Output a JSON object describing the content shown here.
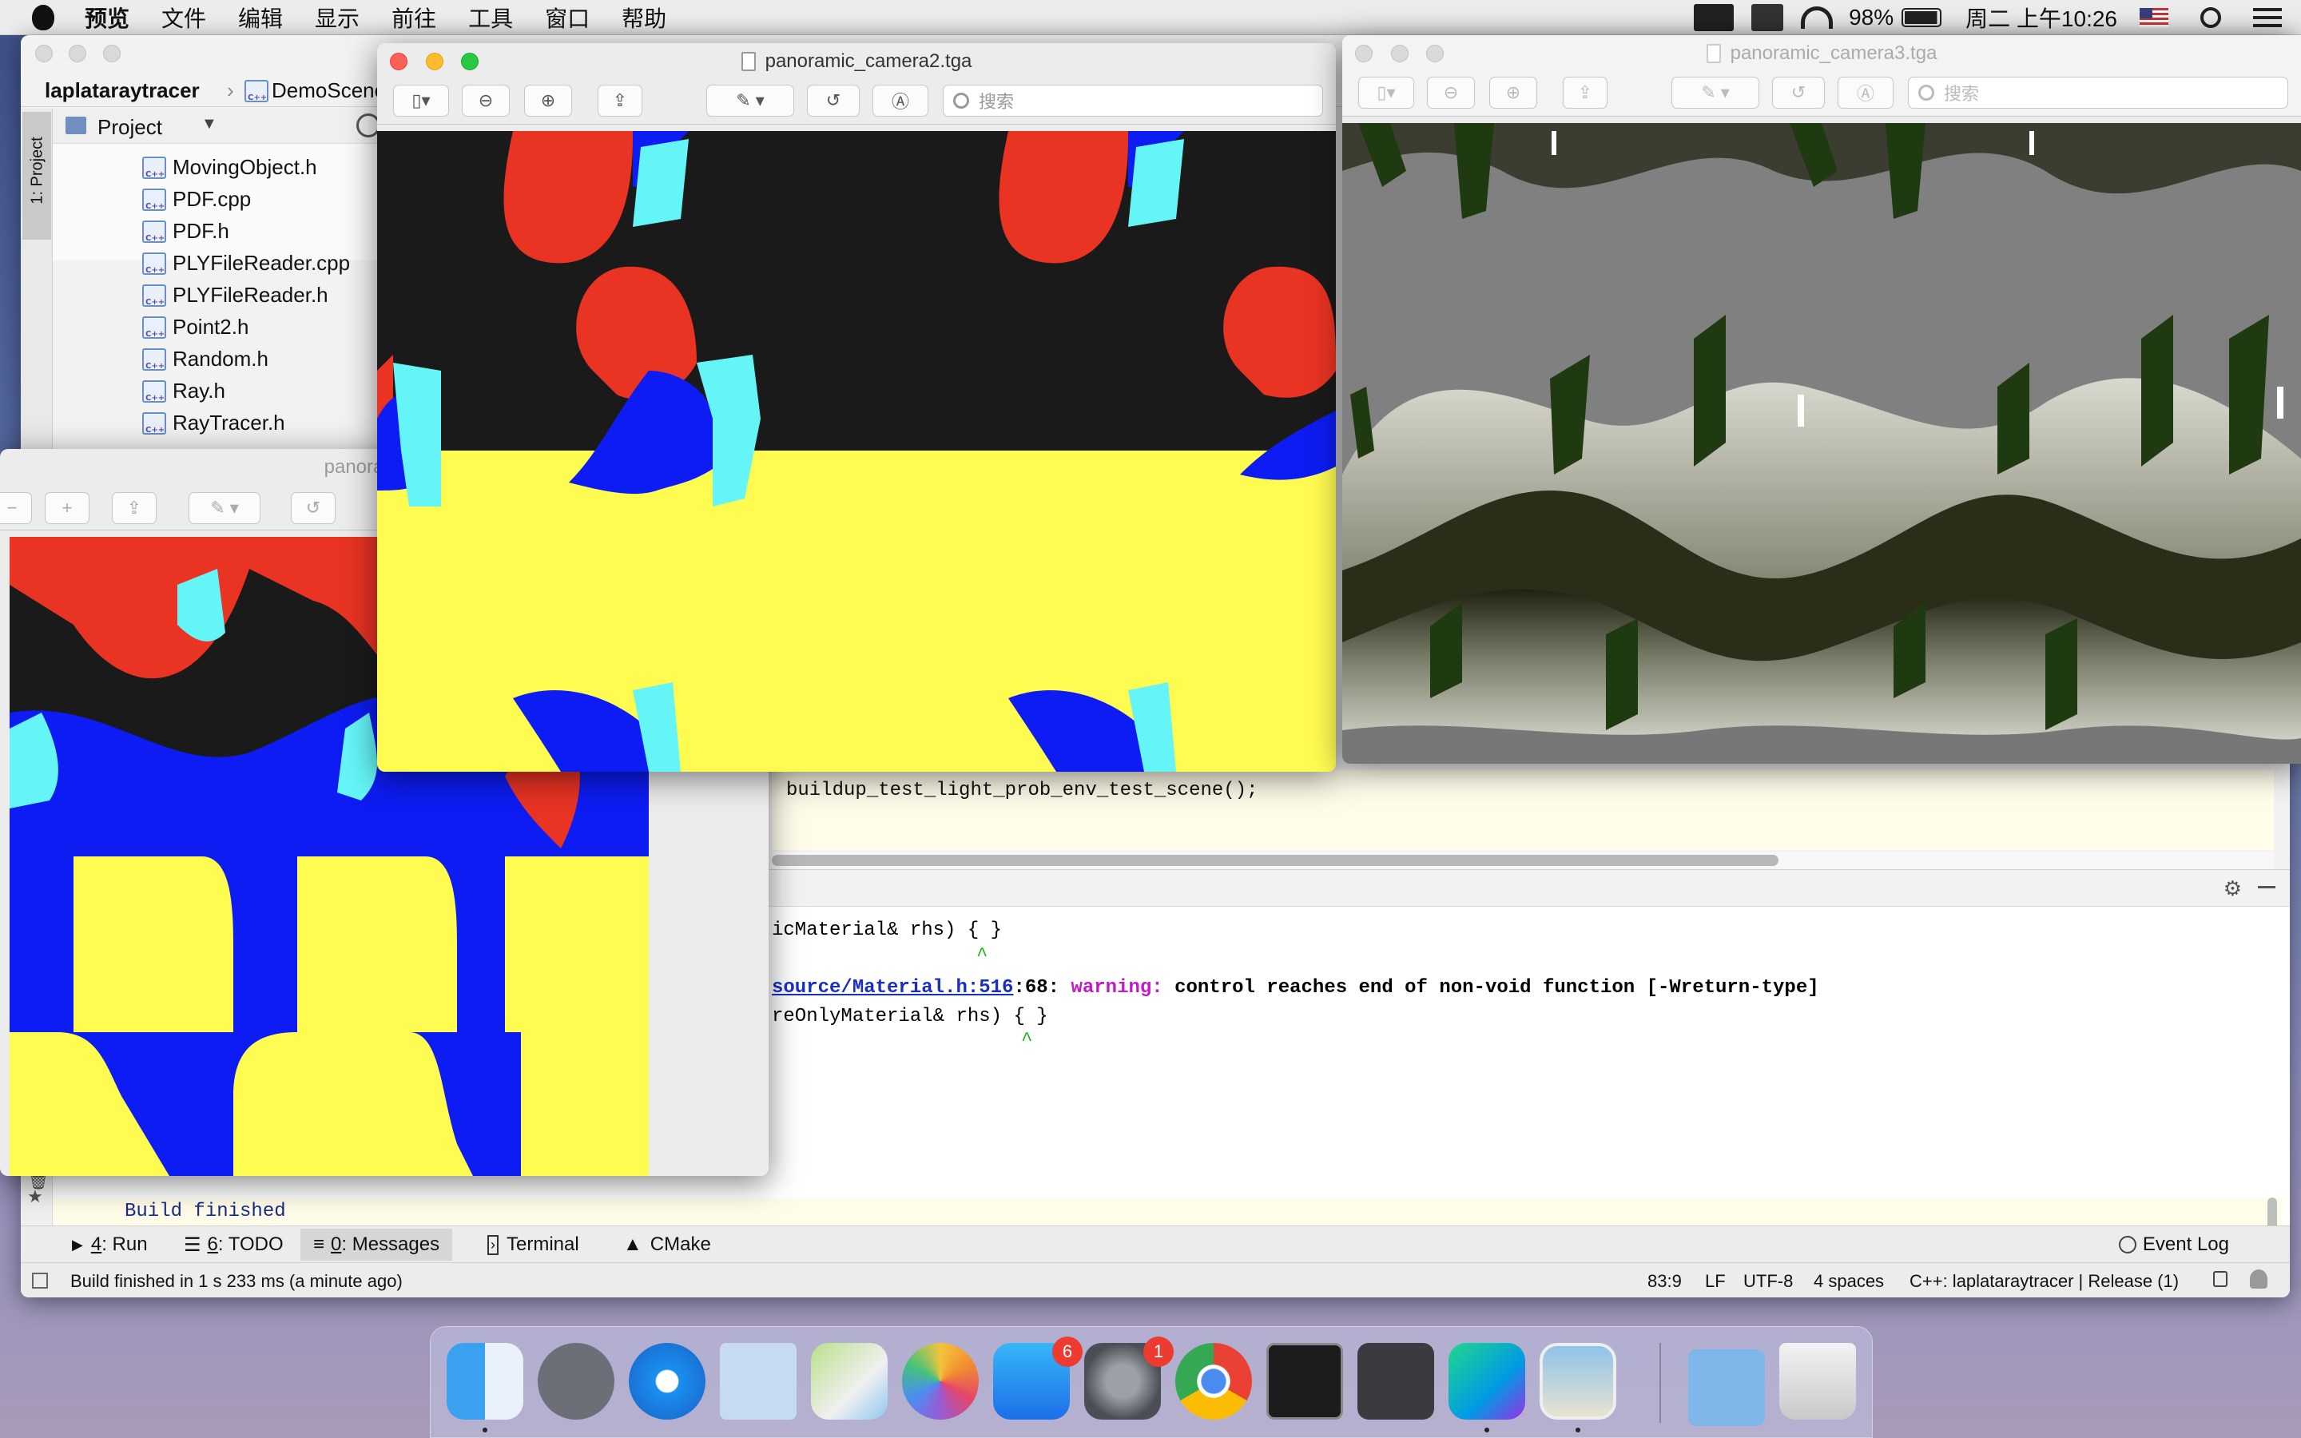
{
  "menubar": {
    "app_name": "预览",
    "items": [
      "文件",
      "编辑",
      "显示",
      "前往",
      "工具",
      "窗口",
      "帮助"
    ],
    "battery": "98%",
    "clock": "周二 上午10:26"
  },
  "ide": {
    "breadcrumb_project": "laplataraytracer",
    "breadcrumb_file": "DemoScene",
    "project_label": "Project",
    "side_tab": "1: Project",
    "files": [
      "MovingObject.h",
      "PDF.cpp",
      "PDF.h",
      "PLYFileReader.cpp",
      "PLYFileReader.h",
      "Point2.h",
      "Random.h",
      "Ray.h",
      "RayTracer.h"
    ],
    "code_lines": [
      "buildup_test_light_prob_env_test_scene();"
    ],
    "messages": [
      {
        "text": "icMaterial& rhs) { }",
        "kind": "code"
      },
      {
        "text": "^",
        "kind": "caret"
      },
      {
        "link": "source/Material.h:516",
        "pos": ":68: ",
        "warn": "warning:",
        "msg": " control reaches end of non-void function [-Wreturn-type]"
      },
      {
        "text": "reOnlyMaterial& rhs) { }",
        "kind": "code"
      },
      {
        "text": "^",
        "kind": "caret"
      }
    ],
    "build_finished": "Build finished",
    "tabs": [
      {
        "num": "4",
        "label": ": Run"
      },
      {
        "num": "6",
        "label": ": TODO"
      },
      {
        "num": "0",
        "label": ": Messages"
      },
      {
        "num": "",
        "label": "Terminal"
      },
      {
        "num": "",
        "label": "CMake"
      }
    ],
    "event_log": "Event Log",
    "status": {
      "message": "Build finished in 1 s 233 ms (a minute ago)",
      "position": "83:9",
      "line_sep": "LF",
      "encoding": "UTF-8",
      "indent": "4 spaces",
      "context": "C++: laplataraytracer | Release (1)"
    }
  },
  "preview_back": {
    "title": "panoramic_cam"
  },
  "preview_main": {
    "title": "panoramic_camera2.tga",
    "search_placeholder": "搜索"
  },
  "preview_right": {
    "title": "panoramic_camera3.tga",
    "search_placeholder": "搜索"
  },
  "dock": {
    "apps": [
      "finder-icon",
      "launchpad-icon",
      "safari-icon",
      "mail-icon",
      "maps-icon",
      "photos-icon",
      "app-store-icon",
      "system-preferences-icon",
      "chrome-icon",
      "terminal-icon",
      "sublime-text-icon",
      "clion-icon",
      "preview-icon",
      "downloads-folder-icon",
      "trash-icon"
    ],
    "app_store_badge": "6",
    "sysprefs_badge": "1"
  },
  "colors": {
    "red": "#e93323",
    "cyan": "#66f5f7",
    "blue": "#0c1cf2",
    "yellow": "#fffc51",
    "black": "#1a1a1a"
  }
}
